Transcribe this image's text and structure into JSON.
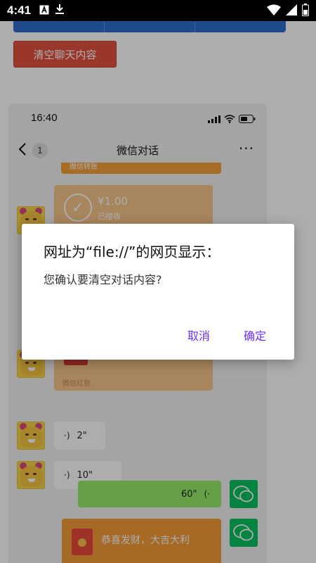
{
  "status_bar": {
    "time": "4:41",
    "icons": [
      "a-box-icon",
      "download-icon",
      "wifi-icon",
      "signal-icon",
      "battery-icon"
    ]
  },
  "page": {
    "clear_button_label": "清空聊天内容"
  },
  "phone": {
    "time": "16:40",
    "nav": {
      "back_count": "1",
      "title": "微信对话",
      "more": "···"
    },
    "transfer_strip_label": "微信转账",
    "money_card": {
      "amount": "¥1.00",
      "status": "已接收"
    },
    "redpacket_footer": "微信红包",
    "voice_messages": [
      {
        "duration": "2\""
      },
      {
        "duration": "10\""
      }
    ],
    "sent_voice": {
      "duration": "60\""
    },
    "sent_redpacket": {
      "text": "恭喜发财，大吉大利"
    }
  },
  "dialog": {
    "title": "网址为“file://”的网页显示：",
    "message": "您确认要清空对话内容?",
    "cancel_label": "取消",
    "ok_label": "确定",
    "accent_color": "#6a2ff5"
  }
}
